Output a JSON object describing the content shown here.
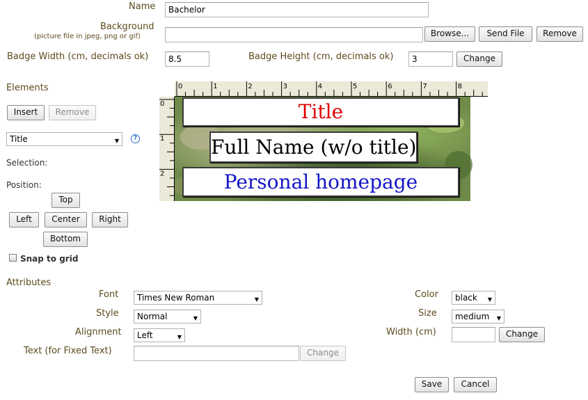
{
  "form": {
    "name_label": "Name",
    "name_value": "Bachelor",
    "background_label": "Background",
    "background_hint": "(picture file in jpeg, png or gif)",
    "background_value": "",
    "browse_label": "Browse...",
    "send_file_label": "Send File",
    "remove_label": "Remove",
    "width_label": "Badge Width (cm, decimals ok)",
    "width_value": "8.5",
    "height_label": "Badge Height (cm, decimals ok)",
    "height_value": "3",
    "change_label": "Change"
  },
  "elements": {
    "heading": "Elements",
    "insert_label": "Insert",
    "remove_label": "Remove",
    "selected": "Title",
    "help_icon": "question-circle-icon",
    "selection_label": "Selection:",
    "position_label": "Position:",
    "top_label": "Top",
    "left_label": "Left",
    "center_label": "Center",
    "right_label": "Right",
    "bottom_label": "Bottom",
    "snap_label": "Snap to grid",
    "snap_checked": false
  },
  "preview": {
    "ruler_top": [
      "0",
      "1",
      "2",
      "3",
      "4",
      "5",
      "6",
      "7",
      "8"
    ],
    "ruler_left": [
      "0",
      "1",
      "2"
    ],
    "boxes": [
      {
        "text": "Title",
        "color": "#e00000"
      },
      {
        "text": "Full Name (w/o title)",
        "color": "#000000"
      },
      {
        "text": "Personal homepage",
        "color": "#1414c8"
      }
    ]
  },
  "attributes": {
    "heading": "Attributes",
    "font_label": "Font",
    "font_value": "Times New Roman",
    "style_label": "Style",
    "style_value": "Normal",
    "alignment_label": "Alignment",
    "alignment_value": "Left",
    "text_label": "Text (for Fixed Text)",
    "text_value": "",
    "text_change_label": "Change",
    "color_label": "Color",
    "color_value": "black",
    "size_label": "Size",
    "size_value": "medium",
    "width_label": "Width (cm)",
    "width_value": "",
    "width_change_label": "Change"
  },
  "actions": {
    "save_label": "Save",
    "cancel_label": "Cancel"
  }
}
